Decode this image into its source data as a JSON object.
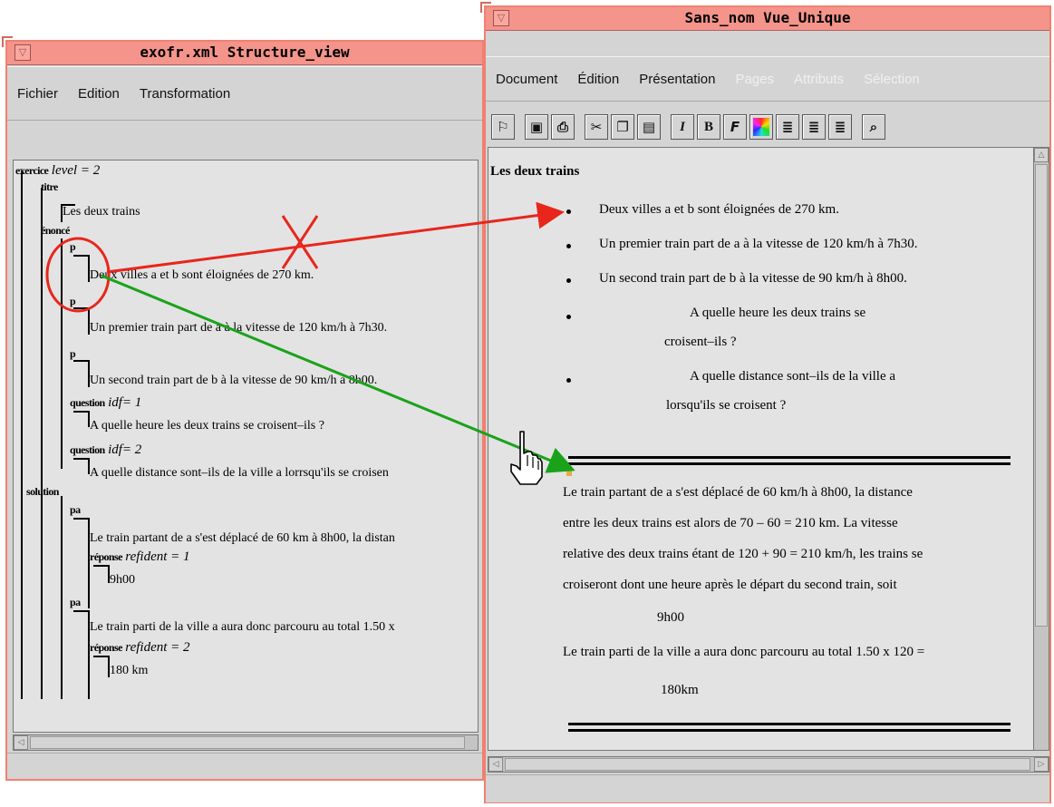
{
  "left_window": {
    "title": "exofr.xml  Structure_view",
    "menu": [
      "Fichier",
      "Edition",
      "Transformation"
    ],
    "tree": {
      "root_tag": "exercice",
      "root_attr": "level = 2",
      "titre_tag": "titre",
      "titre_text": "Les deux trains",
      "enonce_tag": "énoncé",
      "p_tag": "p",
      "p1": "Deux villes a et b sont éloignées de 270 km.",
      "p2": "Un premier train part de a à la vitesse de 120 km/h à 7h30.",
      "p3": "Un second train part de b à la vitesse de 90 km/h à 8h00.",
      "question_tag": "question",
      "q1_attr": "idf= 1",
      "q1_text": "A quelle heure les deux trains se croisent–ils ?",
      "q2_attr": "idf= 2",
      "q2_text": "A quelle distance sont–ils de la ville a lorrsqu'ils se croisen",
      "solution_tag": "solution",
      "pa_tag": "pa",
      "pa1_text": "Le train partant de a s'est déplacé de 60 km à 8h00, la distan",
      "reponse_tag": "réponse",
      "r1_attr": "refident = 1",
      "r1_text": "9h00",
      "pa2_text": "Le train parti de la ville a aura donc parcouru au total 1.50 x",
      "r2_attr": "refident = 2",
      "r2_text": "180 km"
    }
  },
  "right_window": {
    "title": "Sans_nom  Vue_Unique",
    "menu": [
      "Document",
      "Édition",
      "Présentation",
      "Pages",
      "Attributs",
      "Sélection"
    ],
    "menu_disabled": [
      "Pages",
      "Attributs",
      "Sélection"
    ],
    "toolbar_icons": [
      "open-icon",
      "save-icon",
      "print-icon",
      "cut-icon",
      "copy-icon",
      "paste-icon",
      "italic-icon",
      "bold-icon",
      "font-icon",
      "color-icon",
      "align-left-icon",
      "align-right-icon",
      "justify-icon",
      "find-icon"
    ],
    "toolbar_glyphs": [
      "I",
      "B",
      "F"
    ],
    "doc": {
      "title": "Les deux trains",
      "items": [
        "Deux villes a et b sont éloignées de 270 km.",
        "Un premier train part de a à la vitesse de 120 km/h à 7h30.",
        "Un second train part de b à la vitesse de 90 km/h à 8h00."
      ],
      "q1_line1": "A quelle heure les deux trains se",
      "q1_line2": "croisent–ils ?",
      "q2_line1": "A quelle distance sont–ils de la ville a",
      "q2_line2": "lorsqu'ils se croisent ?",
      "sol_lines": [
        "Le train partant de a s'est déplacé de 60 km/h à 8h00, la distance",
        "entre les deux trains est alors de 70 – 60 = 210 km. La vitesse",
        "relative des deux trains étant de 120 + 90 = 210 km/h, les trains se",
        "croiseront dont une heure après le départ du second train, soit"
      ],
      "answer1": "9h00",
      "sol2_line": "Le train parti de la ville a aura donc parcouru au total 1.50 x 120 =",
      "answer2": "180km"
    }
  },
  "annotations": {
    "red_arrow_color": "#e8261c",
    "green_arrow_color": "#1aa21a",
    "cross_mark_color": "#e8261c",
    "circle_color": "#e8261c"
  }
}
